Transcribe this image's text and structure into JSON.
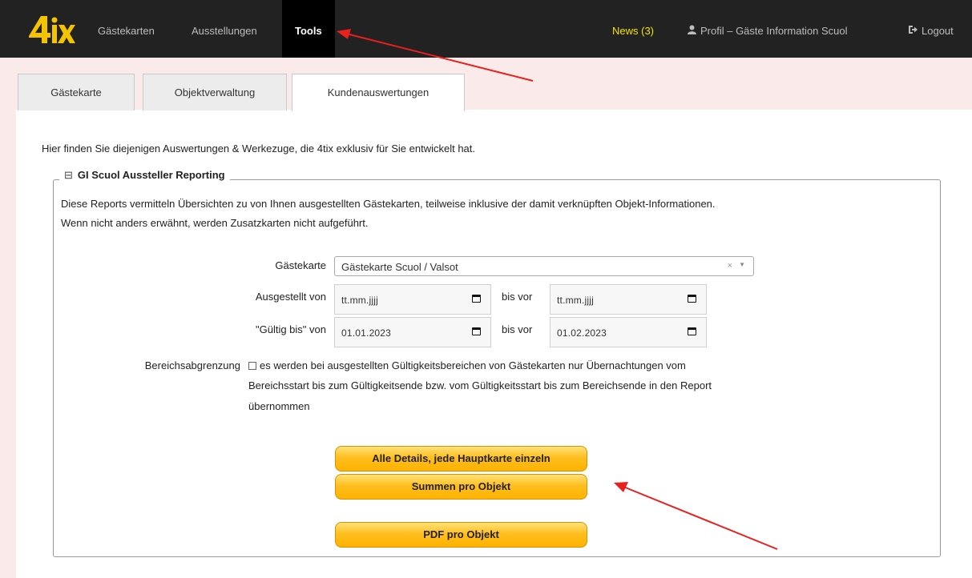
{
  "navbar": {
    "logo_text": "4ix",
    "items": [
      {
        "label": "Gästekarten"
      },
      {
        "label": "Ausstellungen"
      },
      {
        "label": "Tools"
      }
    ],
    "news_label": "News (3)",
    "profile_label": "Profil – Gäste Information Scuol",
    "logout_label": "Logout",
    "profile_icon": "user-icon",
    "logout_icon": "logout-icon"
  },
  "tabs": [
    {
      "label": "Gästekarte"
    },
    {
      "label": "Objektverwaltung"
    },
    {
      "label": "Kundenauswertungen",
      "active": true
    }
  ],
  "intro": "Hier finden Sie diejenigen Auswertungen & Werkezuge, die 4tix exklusiv für Sie entwickelt hat.",
  "section": {
    "collapse_icon": "⊟",
    "title": "GI Scuol Aussteller Reporting",
    "desc_line1": "Diese Reports vermitteln Übersichten zu von Ihnen ausgestellten Gästekarten, teilweise inklusive der damit verknüpften Objekt-Informationen.",
    "desc_line2": "Wenn nicht anders erwähnt, werden Zusatzkarten nicht aufgeführt."
  },
  "form": {
    "gaestekarte_label": "Gästekarte",
    "gaestekarte_value": "Gästekarte Scuol / Valsot",
    "clear_symbol": "×",
    "dropdown_symbol": "▼",
    "ausgestellt_label": "Ausgestellt von",
    "ausgestellt_from": "tt.mm.jjjj",
    "ausgestellt_to": "tt.mm.jjjj",
    "bis_vor_label": "bis vor",
    "gueltig_label": "\"Gültig bis\" von",
    "gueltig_from": "01.01.2023",
    "gueltig_to": "01.02.2023",
    "bereich_label": "Bereichsabgrenzung",
    "bereich_line1": "es werden bei ausgestellten Gültigkeitsbereichen von Gästekarten nur Übernachtungen vom",
    "bereich_line2": "Bereichsstart bis zum Gültigkeitsende bzw. vom Gültigkeitsstart bis zum Bereichsende in den Report",
    "bereich_line3": "übernommen",
    "bereich_checked": false
  },
  "buttons": {
    "details": "Alle Details, jede Hauptkarte einzeln",
    "summen": "Summen pro Objekt",
    "pdf": "PDF pro Objekt"
  },
  "colors": {
    "navbar": "#222222",
    "news": "#f5e400",
    "band": "#fbeaea",
    "button": "#ffbf1f",
    "annotation_arrow": "#e8201e"
  }
}
